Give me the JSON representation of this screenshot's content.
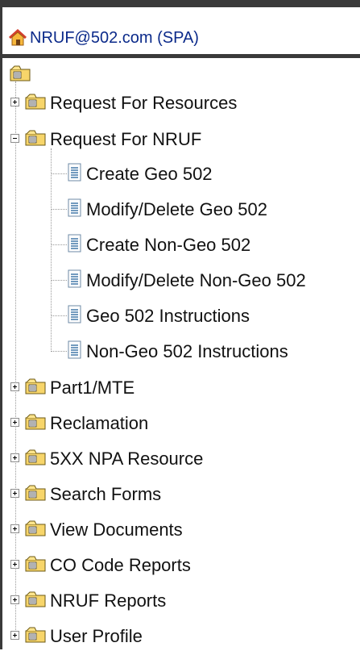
{
  "header": {
    "account_label": "NRUF@502.com (SPA)",
    "home_icon": "home-icon"
  },
  "tree": {
    "root_icon": "folder-icon",
    "items": [
      {
        "label": "Request For Resources",
        "expanded": false
      },
      {
        "label": "Request For NRUF",
        "expanded": true,
        "children": [
          {
            "label": "Create Geo 502"
          },
          {
            "label": "Modify/Delete Geo 502"
          },
          {
            "label": "Create Non-Geo 502"
          },
          {
            "label": "Modify/Delete Non-Geo 502"
          },
          {
            "label": "Geo 502 Instructions"
          },
          {
            "label": "Non-Geo 502 Instructions"
          }
        ]
      },
      {
        "label": "Part1/MTE",
        "expanded": false
      },
      {
        "label": "Reclamation",
        "expanded": false
      },
      {
        "label": "5XX NPA Resource",
        "expanded": false
      },
      {
        "label": "Search Forms",
        "expanded": false
      },
      {
        "label": "View Documents",
        "expanded": false
      },
      {
        "label": "CO Code Reports",
        "expanded": false
      },
      {
        "label": "NRUF Reports",
        "expanded": false
      },
      {
        "label": "User Profile",
        "expanded": false
      }
    ]
  },
  "colors": {
    "link": "#0b2a8a",
    "frame": "#3a3a3a",
    "folder": "#f2c94c"
  }
}
